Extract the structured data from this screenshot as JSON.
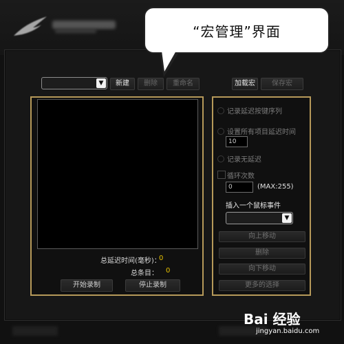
{
  "callout": {
    "text": "“宏管理”界面"
  },
  "toolbar": {
    "new_label": "新建",
    "delete_label": "删除",
    "rename_label": "重命名",
    "load_label": "加载宏",
    "save_label": "保存宏"
  },
  "macro_select": {
    "value": "",
    "arrow": "▼"
  },
  "left_panel": {
    "total_delay_label": "总延迟时间(毫秒)：",
    "total_delay_value": "0",
    "total_items_label": "总条目：",
    "total_items_value": "0",
    "start_record_label": "开始录制",
    "stop_record_label": "停止录制"
  },
  "right_panel": {
    "option_record_delay": "记录延迟按键序列",
    "option_set_all_delay": "设置所有项目延迟时间",
    "delay_value": "10",
    "option_no_delay": "记录无延迟",
    "loop_label": "循环次数",
    "loop_value": "0",
    "loop_max": "(MAX:255)",
    "insert_mouse_label": "插入一个鼠标事件",
    "insert_mouse_value": "",
    "insert_arrow": "▼",
    "move_up_label": "向上移动",
    "delete_label": "删除",
    "move_down_label": "向下移动",
    "more_options_label": "更多的选择"
  },
  "watermark": {
    "main": "Bai 经验",
    "url": "jingyan.baidu.com"
  },
  "colors": {
    "accent_gold": "#b79a5a",
    "value_yellow": "#e6c000"
  }
}
